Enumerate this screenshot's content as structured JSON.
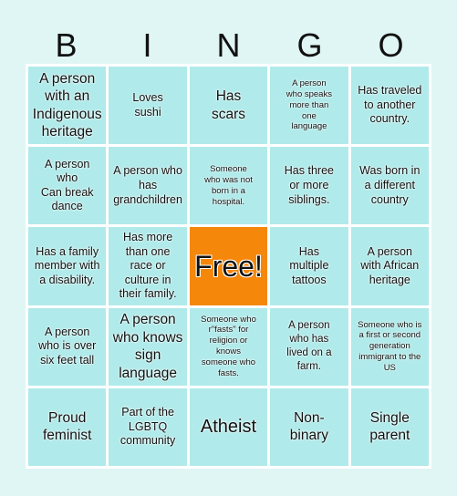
{
  "header": {
    "letters": [
      "B",
      "I",
      "N",
      "G",
      "O"
    ]
  },
  "colors": {
    "background": "#e0f6f4",
    "cell": "#b1eaea",
    "free_cell": "#f5870a",
    "border": "#ffffff"
  },
  "cells": [
    [
      "A person\nwith an\nIndigenous\nheritage",
      "Loves\nsushi",
      "Has\nscars",
      "A person\nwho speaks\nmore than\none\nlanguage",
      "Has traveled\nto another\ncountry."
    ],
    [
      "A person\nwho\nCan break\ndance",
      "A person who\nhas\ngrandchildren",
      "Someone\nwho was not\nborn in a\nhospital.",
      "Has three\nor more\nsiblings.",
      "Was born in\na different\ncountry"
    ],
    [
      "Has a family\nmember with\na disability.",
      "Has more\nthan one\nrace or\nculture in\ntheir family.",
      "Free!",
      "Has\nmultiple\ntattoos",
      "A person\nwith African\nheritage"
    ],
    [
      "A person\nwho is over\nsix feet tall",
      "A person\nwho knows\nsign\nlanguage",
      "Someone who\nr\"fasts\" for\nreligion or\nknows\nsomeone who\nfasts.",
      "A person\nwho has\nlived on a\nfarm.",
      "Someone who is\na first or second\ngeneration\nimmigrant to the\nUS"
    ],
    [
      "Proud\nfeminist",
      "Part of the\nLGBTQ\ncommunity",
      "Atheist",
      "Non-\nbinary",
      "Single\nparent"
    ]
  ]
}
